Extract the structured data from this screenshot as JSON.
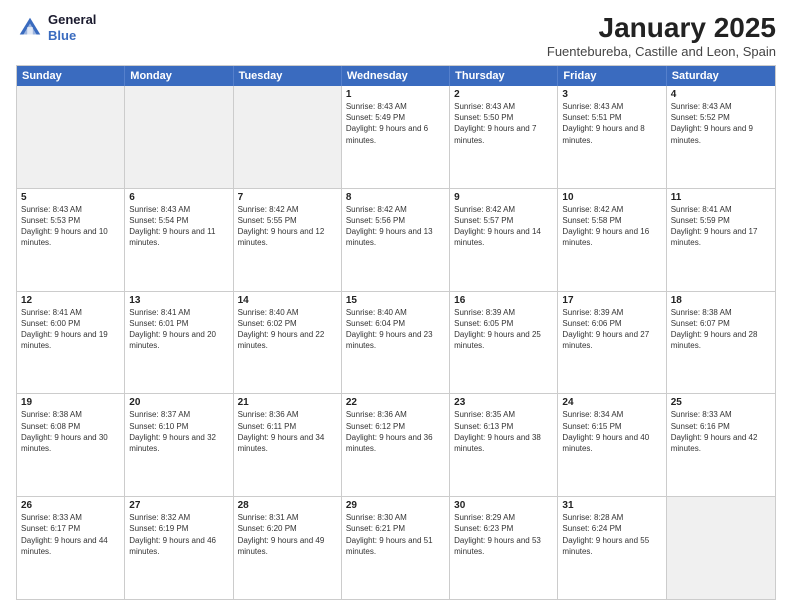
{
  "logo": {
    "line1": "General",
    "line2": "Blue"
  },
  "title": "January 2025",
  "location": "Fuentebureba, Castille and Leon, Spain",
  "days_of_week": [
    "Sunday",
    "Monday",
    "Tuesday",
    "Wednesday",
    "Thursday",
    "Friday",
    "Saturday"
  ],
  "weeks": [
    [
      {
        "day": "",
        "text": "",
        "shaded": true
      },
      {
        "day": "",
        "text": "",
        "shaded": true
      },
      {
        "day": "",
        "text": "",
        "shaded": true
      },
      {
        "day": "1",
        "text": "Sunrise: 8:43 AM\nSunset: 5:49 PM\nDaylight: 9 hours and 6 minutes.",
        "shaded": false
      },
      {
        "day": "2",
        "text": "Sunrise: 8:43 AM\nSunset: 5:50 PM\nDaylight: 9 hours and 7 minutes.",
        "shaded": false
      },
      {
        "day": "3",
        "text": "Sunrise: 8:43 AM\nSunset: 5:51 PM\nDaylight: 9 hours and 8 minutes.",
        "shaded": false
      },
      {
        "day": "4",
        "text": "Sunrise: 8:43 AM\nSunset: 5:52 PM\nDaylight: 9 hours and 9 minutes.",
        "shaded": false
      }
    ],
    [
      {
        "day": "5",
        "text": "Sunrise: 8:43 AM\nSunset: 5:53 PM\nDaylight: 9 hours and 10 minutes.",
        "shaded": false
      },
      {
        "day": "6",
        "text": "Sunrise: 8:43 AM\nSunset: 5:54 PM\nDaylight: 9 hours and 11 minutes.",
        "shaded": false
      },
      {
        "day": "7",
        "text": "Sunrise: 8:42 AM\nSunset: 5:55 PM\nDaylight: 9 hours and 12 minutes.",
        "shaded": false
      },
      {
        "day": "8",
        "text": "Sunrise: 8:42 AM\nSunset: 5:56 PM\nDaylight: 9 hours and 13 minutes.",
        "shaded": false
      },
      {
        "day": "9",
        "text": "Sunrise: 8:42 AM\nSunset: 5:57 PM\nDaylight: 9 hours and 14 minutes.",
        "shaded": false
      },
      {
        "day": "10",
        "text": "Sunrise: 8:42 AM\nSunset: 5:58 PM\nDaylight: 9 hours and 16 minutes.",
        "shaded": false
      },
      {
        "day": "11",
        "text": "Sunrise: 8:41 AM\nSunset: 5:59 PM\nDaylight: 9 hours and 17 minutes.",
        "shaded": false
      }
    ],
    [
      {
        "day": "12",
        "text": "Sunrise: 8:41 AM\nSunset: 6:00 PM\nDaylight: 9 hours and 19 minutes.",
        "shaded": false
      },
      {
        "day": "13",
        "text": "Sunrise: 8:41 AM\nSunset: 6:01 PM\nDaylight: 9 hours and 20 minutes.",
        "shaded": false
      },
      {
        "day": "14",
        "text": "Sunrise: 8:40 AM\nSunset: 6:02 PM\nDaylight: 9 hours and 22 minutes.",
        "shaded": false
      },
      {
        "day": "15",
        "text": "Sunrise: 8:40 AM\nSunset: 6:04 PM\nDaylight: 9 hours and 23 minutes.",
        "shaded": false
      },
      {
        "day": "16",
        "text": "Sunrise: 8:39 AM\nSunset: 6:05 PM\nDaylight: 9 hours and 25 minutes.",
        "shaded": false
      },
      {
        "day": "17",
        "text": "Sunrise: 8:39 AM\nSunset: 6:06 PM\nDaylight: 9 hours and 27 minutes.",
        "shaded": false
      },
      {
        "day": "18",
        "text": "Sunrise: 8:38 AM\nSunset: 6:07 PM\nDaylight: 9 hours and 28 minutes.",
        "shaded": false
      }
    ],
    [
      {
        "day": "19",
        "text": "Sunrise: 8:38 AM\nSunset: 6:08 PM\nDaylight: 9 hours and 30 minutes.",
        "shaded": false
      },
      {
        "day": "20",
        "text": "Sunrise: 8:37 AM\nSunset: 6:10 PM\nDaylight: 9 hours and 32 minutes.",
        "shaded": false
      },
      {
        "day": "21",
        "text": "Sunrise: 8:36 AM\nSunset: 6:11 PM\nDaylight: 9 hours and 34 minutes.",
        "shaded": false
      },
      {
        "day": "22",
        "text": "Sunrise: 8:36 AM\nSunset: 6:12 PM\nDaylight: 9 hours and 36 minutes.",
        "shaded": false
      },
      {
        "day": "23",
        "text": "Sunrise: 8:35 AM\nSunset: 6:13 PM\nDaylight: 9 hours and 38 minutes.",
        "shaded": false
      },
      {
        "day": "24",
        "text": "Sunrise: 8:34 AM\nSunset: 6:15 PM\nDaylight: 9 hours and 40 minutes.",
        "shaded": false
      },
      {
        "day": "25",
        "text": "Sunrise: 8:33 AM\nSunset: 6:16 PM\nDaylight: 9 hours and 42 minutes.",
        "shaded": false
      }
    ],
    [
      {
        "day": "26",
        "text": "Sunrise: 8:33 AM\nSunset: 6:17 PM\nDaylight: 9 hours and 44 minutes.",
        "shaded": false
      },
      {
        "day": "27",
        "text": "Sunrise: 8:32 AM\nSunset: 6:19 PM\nDaylight: 9 hours and 46 minutes.",
        "shaded": false
      },
      {
        "day": "28",
        "text": "Sunrise: 8:31 AM\nSunset: 6:20 PM\nDaylight: 9 hours and 49 minutes.",
        "shaded": false
      },
      {
        "day": "29",
        "text": "Sunrise: 8:30 AM\nSunset: 6:21 PM\nDaylight: 9 hours and 51 minutes.",
        "shaded": false
      },
      {
        "day": "30",
        "text": "Sunrise: 8:29 AM\nSunset: 6:23 PM\nDaylight: 9 hours and 53 minutes.",
        "shaded": false
      },
      {
        "day": "31",
        "text": "Sunrise: 8:28 AM\nSunset: 6:24 PM\nDaylight: 9 hours and 55 minutes.",
        "shaded": false
      },
      {
        "day": "",
        "text": "",
        "shaded": true
      }
    ]
  ]
}
